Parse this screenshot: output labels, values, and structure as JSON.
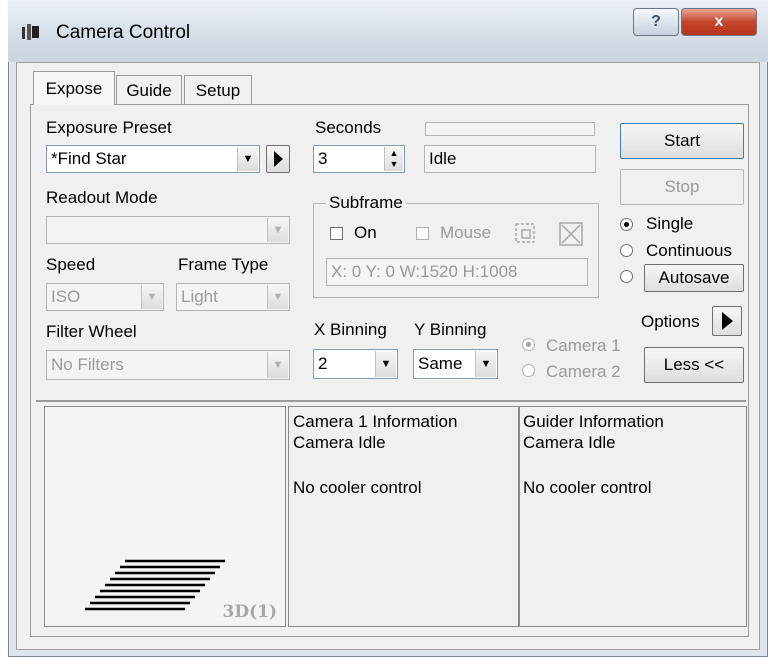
{
  "window": {
    "title": "Camera Control",
    "help_label": "?",
    "close_label": "x"
  },
  "tabs": [
    {
      "label": "Expose"
    },
    {
      "label": "Guide"
    },
    {
      "label": "Setup"
    }
  ],
  "exposure": {
    "preset_label": "Exposure Preset",
    "preset_value": "*Find Star",
    "seconds_label": "Seconds",
    "seconds_value": "3",
    "status_value": "Idle"
  },
  "readout": {
    "label": "Readout Mode",
    "value": ""
  },
  "speed": {
    "label": "Speed",
    "value": "ISO"
  },
  "frame_type": {
    "label": "Frame Type",
    "value": "Light"
  },
  "filter": {
    "label": "Filter Wheel",
    "value": "No Filters"
  },
  "subframe": {
    "title": "Subframe",
    "on_label": "On",
    "mouse_label": "Mouse",
    "coords": "X:  0 Y:  0 W:1520 H:1008"
  },
  "binning": {
    "x_label": "X Binning",
    "x_value": "2",
    "y_label": "Y Binning",
    "y_value": "Same"
  },
  "camera_select": {
    "camera1": "Camera 1",
    "camera2": "Camera 2",
    "selected": "Camera 1"
  },
  "buttons": {
    "start": "Start",
    "stop": "Stop",
    "autosave": "Autosave",
    "options": "Options",
    "less": "Less <<"
  },
  "mode": {
    "single": "Single",
    "continuous": "Continuous",
    "selected": "Single"
  },
  "preview": {
    "badge": "3D(1)"
  },
  "camera_info": {
    "title": "Camera 1 Information",
    "status": "Camera Idle",
    "cooler": "No cooler control"
  },
  "guider_info": {
    "title": "Guider Information",
    "status": "Camera Idle",
    "cooler": "No cooler control"
  }
}
